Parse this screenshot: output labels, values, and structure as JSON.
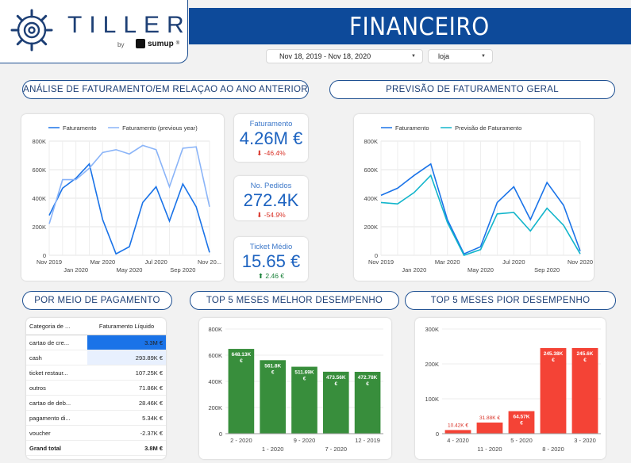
{
  "brand": {
    "logo_text": "TILLER",
    "by": "by",
    "partner": "sumup",
    "partner_mark": "®"
  },
  "header": {
    "title": "FINANCEIRO"
  },
  "filters": {
    "date_range": "Nov 18, 2019 - Nov 18, 2020",
    "store": "loja"
  },
  "sections": {
    "revenue_analysis": "ANÁLISE DE FATURAMENTO/EM RELAÇAO AO ANO ANTERIOR",
    "forecast": "PREVISÃO DE FATURAMENTO GERAL",
    "payment": "POR MEIO DE PAGAMENTO",
    "top5_best": "TOP 5 MESES MELHOR DESEMPENHO",
    "top5_worst": "TOP 5 MESES PIOR DESEMPENHO"
  },
  "kpis": [
    {
      "label": "Faturamento",
      "value": "4.26M €",
      "delta": "-46.4%",
      "direction": "down"
    },
    {
      "label": "No. Pedidos",
      "value": "272.4K",
      "delta": "-54.9%",
      "direction": "down"
    },
    {
      "label": "Ticket Médio",
      "value": "15.65 €",
      "delta": "2.46 €",
      "direction": "up"
    }
  ],
  "payment_table": {
    "headers": [
      "Categoria de ...",
      "Faturamento Líquido"
    ],
    "rows": [
      {
        "category": "cartao de cre...",
        "value": "3.3M €",
        "fill": 1.0
      },
      {
        "category": "cash",
        "value": "293.89K €",
        "fill": 0.09
      },
      {
        "category": "ticket restaur...",
        "value": "107.25K €",
        "fill": 0.03
      },
      {
        "category": "outros",
        "value": "71.86K €",
        "fill": 0.02
      },
      {
        "category": "cartao de deb...",
        "value": "28.46K €",
        "fill": 0.01
      },
      {
        "category": "pagamento di...",
        "value": "5.34K €",
        "fill": 0.0
      },
      {
        "category": "voucher",
        "value": "-2.37K €",
        "fill": 0.0
      }
    ],
    "total": {
      "label": "Grand total",
      "value": "3.8M €"
    }
  },
  "chart_data": [
    {
      "type": "line",
      "legend": [
        "Faturamento",
        "Faturamento (previous year)"
      ],
      "x_ticks_top": [
        "Nov 2019",
        "Mar 2020",
        "Jul 2020",
        "Nov 20..."
      ],
      "x_ticks_bottom": [
        "Jan 2020",
        "May 2020",
        "Sep 2020"
      ],
      "y_ticks": [
        "0",
        "200K",
        "400K",
        "600K",
        "800K"
      ],
      "ylim": [
        0,
        800000
      ],
      "x": [
        "Nov 2019",
        "Dec 2019",
        "Jan 2020",
        "Feb 2020",
        "Mar 2020",
        "Apr 2020",
        "May 2020",
        "Jun 2020",
        "Jul 2020",
        "Aug 2020",
        "Sep 2020",
        "Oct 2020",
        "Nov 2020"
      ],
      "series": [
        {
          "name": "Faturamento",
          "color": "#1a73e8",
          "values": [
            280000,
            470000,
            540000,
            640000,
            250000,
            10000,
            60000,
            370000,
            480000,
            240000,
            500000,
            340000,
            20000
          ]
        },
        {
          "name": "Faturamento (previous year)",
          "color": "#8ab4f8",
          "values": [
            220000,
            530000,
            530000,
            610000,
            720000,
            740000,
            710000,
            770000,
            740000,
            480000,
            750000,
            760000,
            340000
          ]
        }
      ]
    },
    {
      "type": "line",
      "legend": [
        "Faturamento",
        "Previsão de Faturamento"
      ],
      "x_ticks_top": [
        "Nov 2019",
        "Mar 2020",
        "Jul 2020",
        "Nov 2020"
      ],
      "x_ticks_bottom": [
        "Jan 2020",
        "May 2020",
        "Sep 2020"
      ],
      "y_ticks": [
        "0",
        "200K",
        "400K",
        "600K",
        "800K"
      ],
      "ylim": [
        0,
        800000
      ],
      "x": [
        "Nov 2019",
        "Dec 2019",
        "Jan 2020",
        "Feb 2020",
        "Mar 2020",
        "Apr 2020",
        "May 2020",
        "Jun 2020",
        "Jul 2020",
        "Aug 2020",
        "Sep 2020",
        "Oct 2020",
        "Nov 2020"
      ],
      "series": [
        {
          "name": "Faturamento",
          "color": "#1a73e8",
          "values": [
            420000,
            470000,
            560000,
            640000,
            250000,
            10000,
            60000,
            370000,
            480000,
            250000,
            510000,
            350000,
            30000
          ]
        },
        {
          "name": "Previsão de Faturamento",
          "color": "#12b5cb",
          "values": [
            370000,
            360000,
            440000,
            560000,
            230000,
            0,
            40000,
            290000,
            300000,
            170000,
            330000,
            210000,
            10000
          ]
        }
      ]
    },
    {
      "type": "bar",
      "categories": [
        "2 - 2020",
        "1 - 2020",
        "9 - 2020",
        "7 - 2020",
        "12 - 2019"
      ],
      "values": [
        648130,
        561800,
        511690,
        473560,
        472780
      ],
      "data_labels": [
        "648.13K €",
        "561.8K €",
        "511.69K €",
        "473.56K €",
        "472.78K €"
      ],
      "y_ticks": [
        "0",
        "200K",
        "400K",
        "600K",
        "800K"
      ],
      "ylim": [
        0,
        800000
      ],
      "color": "#388e3c"
    },
    {
      "type": "bar",
      "categories": [
        "4 - 2020",
        "11 - 2020",
        "5 - 2020",
        "8 - 2020",
        "3 - 2020"
      ],
      "values": [
        10420,
        31880,
        64570,
        245380,
        245600
      ],
      "data_labels": [
        "10.42K €",
        "31.88K €",
        "64.57K €",
        "245.38K €",
        "245.6K €"
      ],
      "y_ticks": [
        "0",
        "100K",
        "200K",
        "300K"
      ],
      "ylim": [
        0,
        300000
      ],
      "color": "#f44336"
    }
  ]
}
